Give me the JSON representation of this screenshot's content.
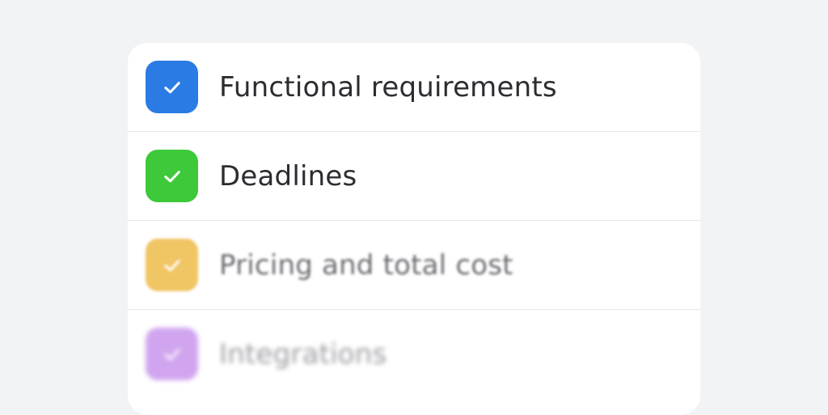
{
  "checklist": {
    "items": [
      {
        "label": "Functional requirements",
        "checked": true,
        "color": "#2b7be5"
      },
      {
        "label": "Deadlines",
        "checked": true,
        "color": "#3ec93a"
      },
      {
        "label": "Pricing and total cost",
        "checked": true,
        "color": "#f0c564"
      },
      {
        "label": "Integrations",
        "checked": true,
        "color": "#c895ec"
      }
    ]
  }
}
